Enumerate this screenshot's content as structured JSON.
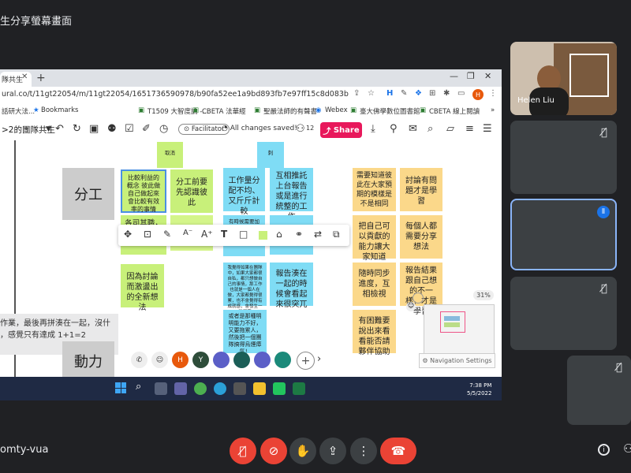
{
  "meet": {
    "presenter_title": "生分享螢幕畫面",
    "meeting_code": "omty-vua",
    "participants": [
      {
        "name": "Helen Liu",
        "mic": "on"
      },
      {
        "name": "",
        "mic": "off"
      },
      {
        "name": "",
        "mic": "speaking"
      },
      {
        "name": "",
        "mic": "off"
      },
      {
        "name": "",
        "mic": "off"
      }
    ]
  },
  "browser": {
    "tab_label": "隊共生",
    "url": "ural.co/t/11gt22054/m/11gt22054/1651736590978/b90fa52ee1a9bd893fb7e97ff15c8d083b96894e?sender=uafa097ba67...",
    "bookmarks": [
      "話研大法...",
      "Bookmarks",
      "T1509 大智度論 -...",
      "CBETA 法華經",
      "聖嚴法師的有聲書",
      "Webex",
      "臺大佛學數位圖書館",
      "CBETA 線上閱讀"
    ]
  },
  "mural": {
    "board_title": ">2的團隊共生",
    "facilitator": "Facilitator",
    "saved": "All changes saved!",
    "member_count": "12",
    "share": "Share",
    "zoom": "31%",
    "nav_settings": "Navigation Settings",
    "left_quote": [
      "作業，最後再拼湊在一起，沒什",
      "，感覺只有達成 1+1=2"
    ],
    "sections": [
      "分工",
      "動力"
    ],
    "top_labels": [
      "取消",
      "刺"
    ],
    "notes": {
      "g1": "比較利益的概念 彼此做自己做起來會比較有效率的事情",
      "g2": "分工前要先認識彼此",
      "g3": "各司其職，已的長處",
      "g4": "因為討論而激盪出的全新想法",
      "b1": "工作量分配不均、又斤斤計較",
      "b2": "互相推託上台報告或是進行統整的工作",
      "b3": "有時候需要加班自己做，做完是又沒感謝",
      "b4": "報告湊在一起的時候會看起來很突兀",
      "b5": "我覺得如果在團隊中，如果大家都很自私，都只想做自己的事情，那工作也就是一個人在做，大家都覺得很累，也不會覺得有成就感，會發生一些衝突",
      "b6": "或者是那種明明能力不好，又要拖累人，然後把一個團隊搞得烏煙瘴氣！",
      "o1": "需要知道彼此在大家預期的模樣是不是相同",
      "o2": "討論有問題才是學習",
      "o3": "把自己可以貢獻的能力讓大家知道",
      "o4": "每個人都需要分享想法",
      "o5": "隨時同步進度，互相檢視",
      "o6": "報告結果跟自己想的不一樣，才是學習",
      "o7": "有困難要說出來看看能否請夥伴協助"
    },
    "avatars": [
      "H",
      "Y"
    ]
  },
  "taskbar": {
    "time": "7:38 PM",
    "date": "5/5/2022"
  },
  "colors": {
    "green_note": "#c8f07a",
    "blue_note": "#7fdcf5",
    "orange_note": "#fbd88a",
    "share_pink": "#e8185b",
    "meet_red": "#ea4335",
    "meet_bg": "#202124"
  }
}
